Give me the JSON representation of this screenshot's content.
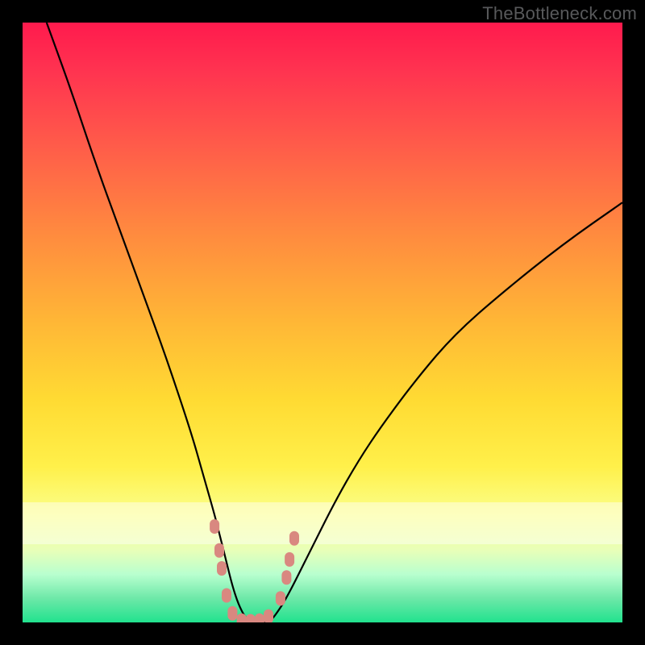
{
  "watermark": "TheBottleneck.com",
  "colors": {
    "frame": "#000000",
    "curve_stroke": "#000000",
    "dot_fill": "#d98880",
    "gradient_top": "#ff1a4d",
    "gradient_bottom": "#21e28e"
  },
  "chart_data": {
    "type": "line",
    "title": "",
    "xlabel": "",
    "ylabel": "",
    "xlim": [
      0,
      100
    ],
    "ylim": [
      0,
      100
    ],
    "grid": false,
    "series": [
      {
        "name": "bottleneck-curve",
        "x": [
          4,
          8,
          12,
          16,
          20,
          24,
          28,
          30,
          32,
          33,
          34,
          35,
          36,
          37,
          38,
          39,
          40,
          41,
          42,
          44,
          48,
          52,
          56,
          60,
          66,
          72,
          80,
          90,
          100
        ],
        "y": [
          100,
          89,
          77,
          66,
          55,
          44,
          32,
          25,
          18,
          14,
          10,
          6,
          3,
          1,
          0,
          0,
          0,
          0,
          1,
          4,
          12,
          20,
          27,
          33,
          41,
          48,
          55,
          63,
          70
        ]
      }
    ],
    "markers": [
      {
        "x": 32.0,
        "y": 16.0
      },
      {
        "x": 32.8,
        "y": 12.0
      },
      {
        "x": 33.2,
        "y": 9.0
      },
      {
        "x": 34.0,
        "y": 4.5
      },
      {
        "x": 35.0,
        "y": 1.5
      },
      {
        "x": 36.5,
        "y": 0.3
      },
      {
        "x": 38.0,
        "y": 0.2
      },
      {
        "x": 39.5,
        "y": 0.3
      },
      {
        "x": 41.0,
        "y": 1.0
      },
      {
        "x": 43.0,
        "y": 4.0
      },
      {
        "x": 44.0,
        "y": 7.5
      },
      {
        "x": 44.5,
        "y": 10.5
      },
      {
        "x": 45.3,
        "y": 14.0
      }
    ],
    "white_band": {
      "y_from": 13,
      "y_to": 20
    }
  }
}
